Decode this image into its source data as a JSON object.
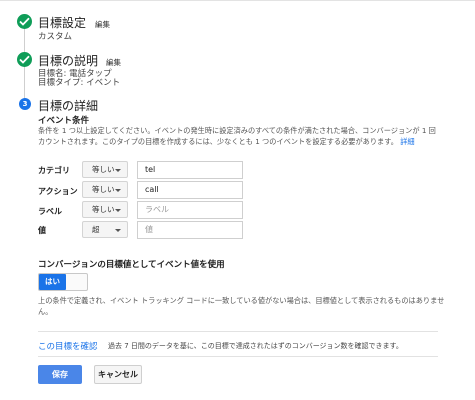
{
  "steps": [
    {
      "title": "目標設定",
      "edit": "編集",
      "lines": [
        "カスタム"
      ]
    },
    {
      "title": "目標の説明",
      "edit": "編集",
      "lines": [
        "目標名: 電話タップ",
        "目標タイプ: イベント"
      ]
    },
    {
      "number": "3",
      "title": "目標の詳細"
    }
  ],
  "event_conditions": {
    "heading": "イベント条件",
    "description": "条件を 1 つ以上設定してください。イベントの発生時に設定済みのすべての条件が満たされた場合、コンバージョンが 1 回カウントされます。このタイプの目標を作成するには、少なくとも 1 つのイベントを設定する必要があります。",
    "description_link": "詳細",
    "rows": [
      {
        "label": "カテゴリ",
        "match": "等しい",
        "value": "tel",
        "placeholder": ""
      },
      {
        "label": "アクション",
        "match": "等しい",
        "value": "call",
        "placeholder": ""
      },
      {
        "label": "ラベル",
        "match": "等しい",
        "value": "",
        "placeholder": "ラベル"
      },
      {
        "label": "値",
        "match": "超",
        "value": "",
        "placeholder": "値"
      }
    ]
  },
  "use_event_value": {
    "heading": "コンバージョンの目標値としてイベント値を使用",
    "toggle_label": "はい",
    "toggle_on": true,
    "note_line1": "上の条件で定義され、イベント トラッキング コードに一致している値がない場合は、目標値として表示されるものはありませ",
    "note_line2": "ん。"
  },
  "verify": {
    "link": "この目標を確認",
    "description": "過去 7 日間のデータを基に、この目標で達成されたはずのコンバージョン数を確認できます。"
  },
  "actions": {
    "save": "保存",
    "cancel": "キャンセル"
  },
  "colors": {
    "check": "#0f9d58",
    "accent": "#1a73e8",
    "primary_button": "#4a86e8"
  }
}
